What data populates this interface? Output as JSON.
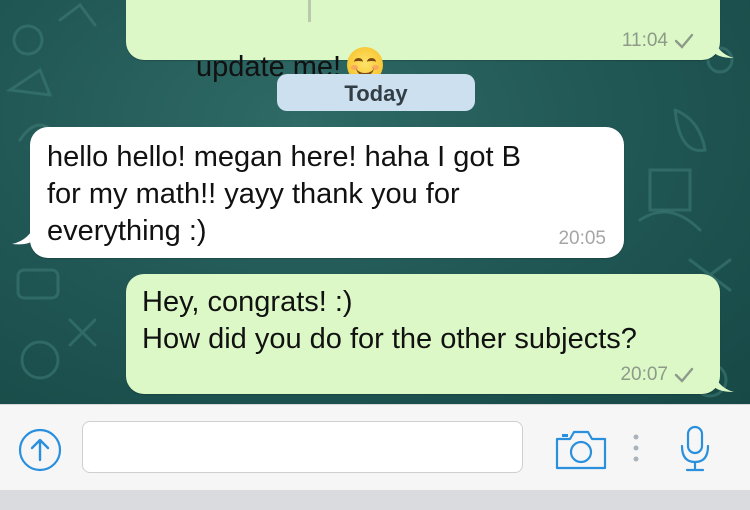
{
  "colors": {
    "wallpaper": "#1f5553",
    "outgoing_bubble": "#dcf8c6",
    "incoming_bubble": "#ffffff",
    "accent_blue": "#2a8fdc",
    "date_pill": "#cce0ef"
  },
  "messages": [
    {
      "direction": "outgoing",
      "text": "update me!",
      "emoji": "smiling-face-emoji",
      "time": "11:04",
      "status": "sent-check"
    },
    {
      "direction": "incoming",
      "text": "hello hello! megan here! haha I got B\nfor my math!! yayy thank you for\neverything :)",
      "time": "20:05"
    },
    {
      "direction": "outgoing",
      "text": "Hey, congrats! :)\nHow did you do for the other subjects?",
      "time": "20:07",
      "status": "sent-check"
    }
  ],
  "date_separator": "Today",
  "input_bar": {
    "upload_icon": "upload-arrow-icon",
    "message_value": "",
    "camera_icon": "camera-icon",
    "more_icon": "vertical-dots-icon",
    "mic_icon": "microphone-icon"
  }
}
